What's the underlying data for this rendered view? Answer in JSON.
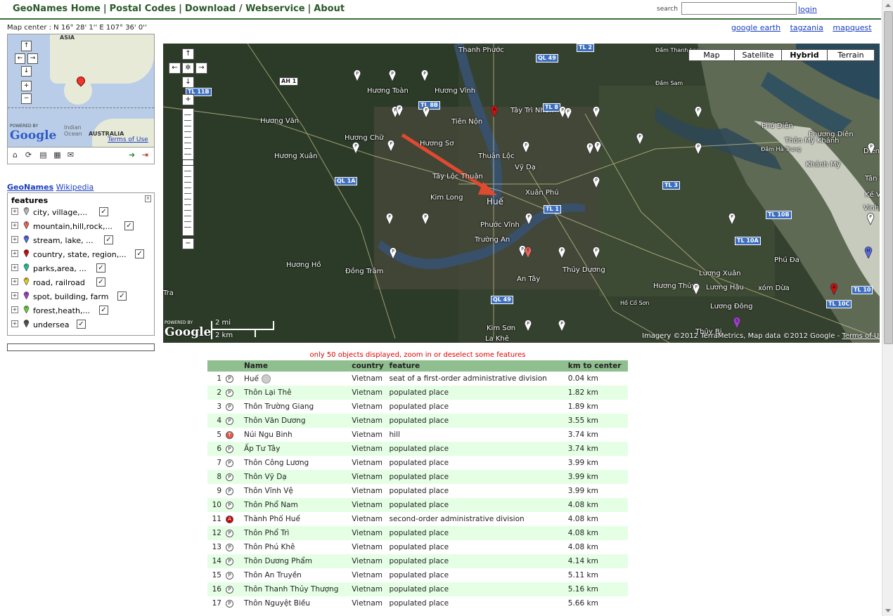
{
  "nav": {
    "items": [
      "GeoNames Home",
      "Postal Codes",
      "Download / Webservice",
      "About"
    ],
    "search_label": "search",
    "search_value": "",
    "login": "login"
  },
  "map_center": "Map center : N 16° 28' 1'' E 107° 36' 0''",
  "ext_links": [
    "google earth",
    "tagzania",
    "mapquest"
  ],
  "overview": {
    "asia": "ASIA",
    "australia": "AUSTRALIA",
    "indian_ocean_1": "Indian",
    "indian_ocean_2": "Ocean",
    "powered_by": "POWERED BY",
    "google": "Google",
    "terms": "Terms of Use"
  },
  "sources": {
    "geonames": "GeoNames",
    "wikipedia": "Wikipedia"
  },
  "features": {
    "title": "features",
    "rows": [
      {
        "label": "city, village,...",
        "color": "#bbbbbb",
        "letter": "P"
      },
      {
        "label": "mountain,hill,rock,...",
        "color": "#e8685a",
        "letter": "T"
      },
      {
        "label": "stream, lake, ...",
        "color": "#5a6ae8",
        "letter": "H"
      },
      {
        "label": "country, state, region,...",
        "color": "#cc1111",
        "letter": "A"
      },
      {
        "label": "parks,area, ...",
        "color": "#22c4a0",
        "letter": "L"
      },
      {
        "label": "road, railroad",
        "color": "#e8d020",
        "letter": "R"
      },
      {
        "label": "spot, building, farm",
        "color": "#a040d0",
        "letter": "S"
      },
      {
        "label": "forest,heath,...",
        "color": "#6ad040",
        "letter": "V"
      },
      {
        "label": "undersea",
        "color": "#555555",
        "letter": "U"
      }
    ]
  },
  "map": {
    "types": [
      "Map",
      "Satellite",
      "Hybrid",
      "Terrain"
    ],
    "active_type": "Hybrid",
    "powered_by": "POWERED BY",
    "google": "Google",
    "scale_mi": "2 mi",
    "scale_km": "2 km",
    "attribution": "Imagery ©2012 TerraMetrics, Map data ©2012 Google - ",
    "terms": "Terms of Use",
    "places": [
      "Thanh Phước",
      "Hương Toàn",
      "Hương Vĩnh",
      "Tây Trì Nhơn",
      "Tiên Nộn",
      "Hương Văn",
      "Hương Chữ",
      "Hương Sơ",
      "Thuận Lộc",
      "Vỹ Dạ",
      "Hương Xuân",
      "Tây Lộc Thuận",
      "Kim Long",
      "Huế",
      "Xuân Phú",
      "Phước Vĩnh",
      "Trường An",
      "Hương Hồ",
      "Đồng Trâm",
      "Thủy Dương",
      "An Tây",
      "Kim Sơn",
      "La Khê",
      "Hương Thủy",
      "Lương Xuân",
      "Lương Hậu",
      "xóm Dừa",
      "Lương Đông",
      "Thủy Bi",
      "Phú Diên",
      "Phương Diên",
      "Thôn Mỹ Khánh",
      "Khánh Mỹ",
      "Tân Sa",
      "Phú Đa",
      "Vinh X",
      "Kế Võ",
      "Diên",
      "Đầm Thanh Lam",
      "Đầm Sam",
      "Đầm Hà Trung",
      "Hồ Cổ Sơn",
      "Tra"
    ],
    "roads": [
      "TL 2",
      "TL 11B",
      "AH 1",
      "TL 8B",
      "TL 3",
      "TL 1",
      "QL 1A",
      "QL 49",
      "QL 49",
      "TL 10A",
      "TL 10B",
      "TL 10C",
      "TL 10",
      "TL 8"
    ]
  },
  "notice": "only 50 objects displayed, zoom in or deselect some features",
  "table": {
    "headers": [
      "",
      "Name",
      "country",
      "feature",
      "km to center"
    ],
    "rows": [
      {
        "n": "1",
        "code": "P",
        "name": "Huế",
        "country": "Vietnam",
        "feature": "seat of a first-order administrative division",
        "km": "0.04 km"
      },
      {
        "n": "2",
        "code": "P",
        "name": "Thôn Lại Thê",
        "country": "Vietnam",
        "feature": "populated place",
        "km": "1.82 km"
      },
      {
        "n": "3",
        "code": "P",
        "name": "Thôn Trường Giang",
        "country": "Vietnam",
        "feature": "populated place",
        "km": "1.89 km"
      },
      {
        "n": "4",
        "code": "P",
        "name": "Thôn Văn Dương",
        "country": "Vietnam",
        "feature": "populated place",
        "km": "3.55 km"
      },
      {
        "n": "5",
        "code": "T",
        "name": "Núi Ngu Binh",
        "country": "Vietnam",
        "feature": "hill",
        "km": "3.74 km"
      },
      {
        "n": "6",
        "code": "P",
        "name": "Ấp Tư Tây",
        "country": "Vietnam",
        "feature": "populated place",
        "km": "3.74 km"
      },
      {
        "n": "7",
        "code": "P",
        "name": "Thôn Công Lương",
        "country": "Vietnam",
        "feature": "populated place",
        "km": "3.99 km"
      },
      {
        "n": "8",
        "code": "P",
        "name": "Thôn Vỹ Dạ",
        "country": "Vietnam",
        "feature": "populated place",
        "km": "3.99 km"
      },
      {
        "n": "9",
        "code": "P",
        "name": "Thôn Vĩnh Vệ",
        "country": "Vietnam",
        "feature": "populated place",
        "km": "3.99 km"
      },
      {
        "n": "10",
        "code": "P",
        "name": "Thôn Phổ Nam",
        "country": "Vietnam",
        "feature": "populated place",
        "km": "4.08 km"
      },
      {
        "n": "11",
        "code": "A",
        "name": "Thành Phố Huế",
        "country": "Vietnam",
        "feature": "second-order administrative division",
        "km": "4.08 km"
      },
      {
        "n": "12",
        "code": "P",
        "name": "Thôn Phổ Trì",
        "country": "Vietnam",
        "feature": "populated place",
        "km": "4.08 km"
      },
      {
        "n": "13",
        "code": "P",
        "name": "Thôn Phú Khê",
        "country": "Vietnam",
        "feature": "populated place",
        "km": "4.08 km"
      },
      {
        "n": "14",
        "code": "P",
        "name": "Thôn Dương Phẩm",
        "country": "Vietnam",
        "feature": "populated place",
        "km": "4.14 km"
      },
      {
        "n": "15",
        "code": "P",
        "name": "Thôn An Truyền",
        "country": "Vietnam",
        "feature": "populated place",
        "km": "5.11 km"
      },
      {
        "n": "16",
        "code": "P",
        "name": "Thôn Thanh Thủy Thượng",
        "country": "Vietnam",
        "feature": "populated place",
        "km": "5.16 km"
      },
      {
        "n": "17",
        "code": "P",
        "name": "Thôn Nguyệt Biều",
        "country": "Vietnam",
        "feature": "populated place",
        "km": "5.66 km"
      }
    ]
  }
}
